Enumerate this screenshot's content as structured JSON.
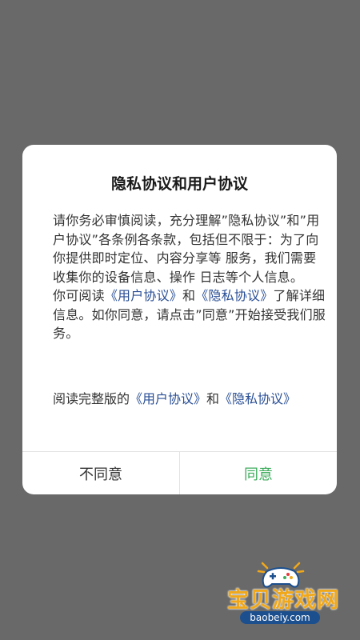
{
  "dialog": {
    "title": "隐私协议和用户协议",
    "paragraph1": "请你务必审慎阅读，充分理解”隐私协议”和”用户协议”各条例各条款，包括但不限于：为了向你提供即时定位、内容分享等 服务，我们需要收集你的设备信息、操作 日志等个人信息。",
    "p2_prefix": "你可阅读",
    "p2_link_user": "《用户协议》",
    "p2_and": "和",
    "p2_link_privacy": "《隐私协议》",
    "p2_suffix": "了解详细信息。如你同意，请点击”同意”开始接受我们服务。",
    "links_prefix": " 阅读完整版的",
    "links_user": "《用户协议》",
    "links_and": "和",
    "links_privacy": "《隐私协议》",
    "disagree_label": "不同意",
    "agree_label": "同意"
  },
  "watermark": {
    "name": "宝贝游戏网",
    "url": "baobeiy.com"
  },
  "colors": {
    "overlay": "#696969",
    "link": "#2a4f95",
    "agree": "#3cab5b",
    "watermark": "#f0a81a"
  }
}
